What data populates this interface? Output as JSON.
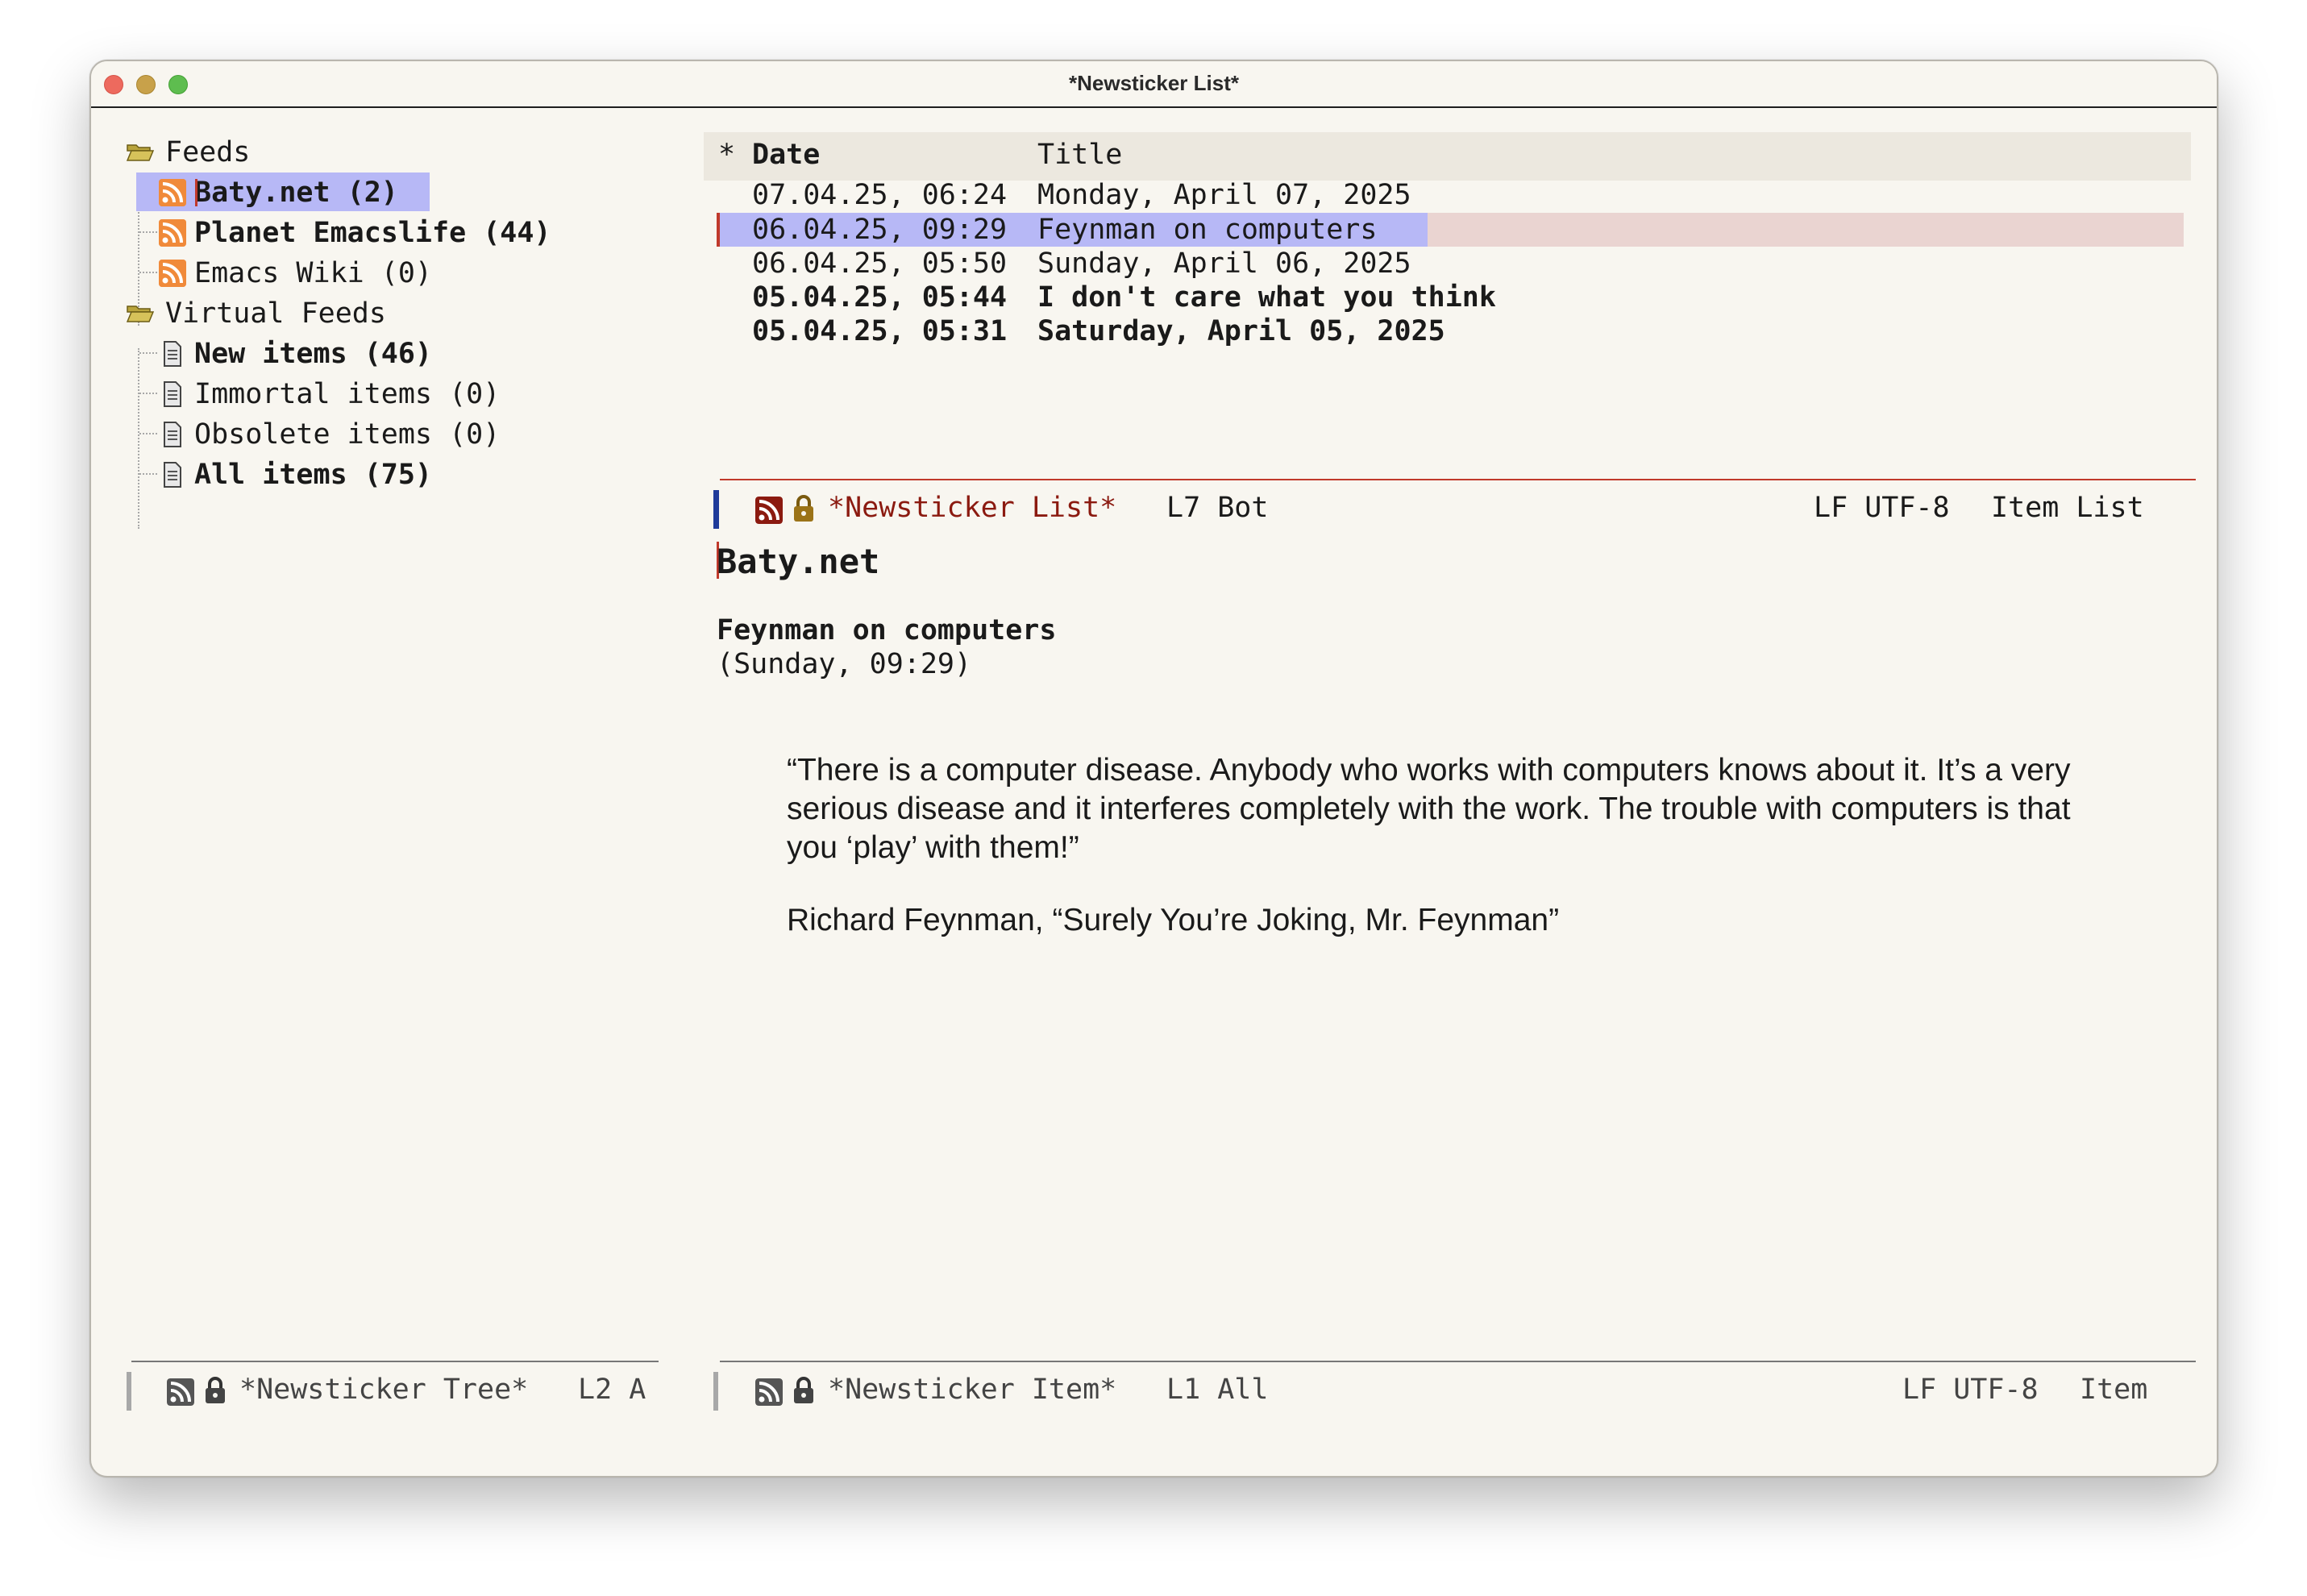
{
  "window": {
    "title": "*Newsticker List*"
  },
  "tree": {
    "feeds_label": "Feeds",
    "feeds": [
      {
        "label": "Baty.net (2)",
        "bold": true
      },
      {
        "label": "Planet Emacslife (44)",
        "bold": true
      },
      {
        "label": "Emacs Wiki (0)",
        "bold": false
      }
    ],
    "virtual_label": "Virtual Feeds",
    "virtual": [
      {
        "label": "New items (46)",
        "bold": true
      },
      {
        "label": "Immortal items (0)",
        "bold": false
      },
      {
        "label": "Obsolete items (0)",
        "bold": false
      },
      {
        "label": "All items (75)",
        "bold": true
      }
    ]
  },
  "list": {
    "header_star": "*",
    "header_date": "Date",
    "header_title": "Title",
    "rows": [
      {
        "date": "07.04.25, 06:24",
        "title": "Monday, April 07, 2025",
        "bold": false
      },
      {
        "date": "06.04.25, 09:29",
        "title": "Feynman on computers",
        "bold": false,
        "selected": true
      },
      {
        "date": "06.04.25, 05:50",
        "title": "Sunday, April 06, 2025",
        "bold": false
      },
      {
        "date": "05.04.25, 05:44",
        "title": "I don't care what you think",
        "bold": true
      },
      {
        "date": "05.04.25, 05:31",
        "title": "Saturday, April 05, 2025",
        "bold": true
      }
    ]
  },
  "modeline_list": {
    "buffer": "*Newsticker List*",
    "position": "L7 Bot",
    "encoding": "LF UTF-8",
    "mode": "Item List"
  },
  "item": {
    "feed": "Baty.net",
    "title": "Feynman on computers",
    "time": "(Sunday, 09:29)",
    "quote": "“There is a computer disease. Anybody who works with computers knows about it. It’s a very serious disease and it interferes completely with the work. The trouble with computers is that you ‘play’ with them!”",
    "attribution": "Richard Feynman, “Surely You’re Joking, Mr. Feynman”"
  },
  "modeline_tree": {
    "buffer": "*Newsticker Tree*",
    "position": "L2 A"
  },
  "modeline_item": {
    "buffer": "*Newsticker Item*",
    "position": "L1 All",
    "encoding": "LF UTF-8",
    "mode": "Item"
  },
  "colors": {
    "accent_selection": "#b7b8f6",
    "row_highlight": "#ead4d1",
    "modeline_buffer": "#8b1a10",
    "rss_orange": "#f08a3a",
    "modeline_separator": "#c0392b"
  }
}
